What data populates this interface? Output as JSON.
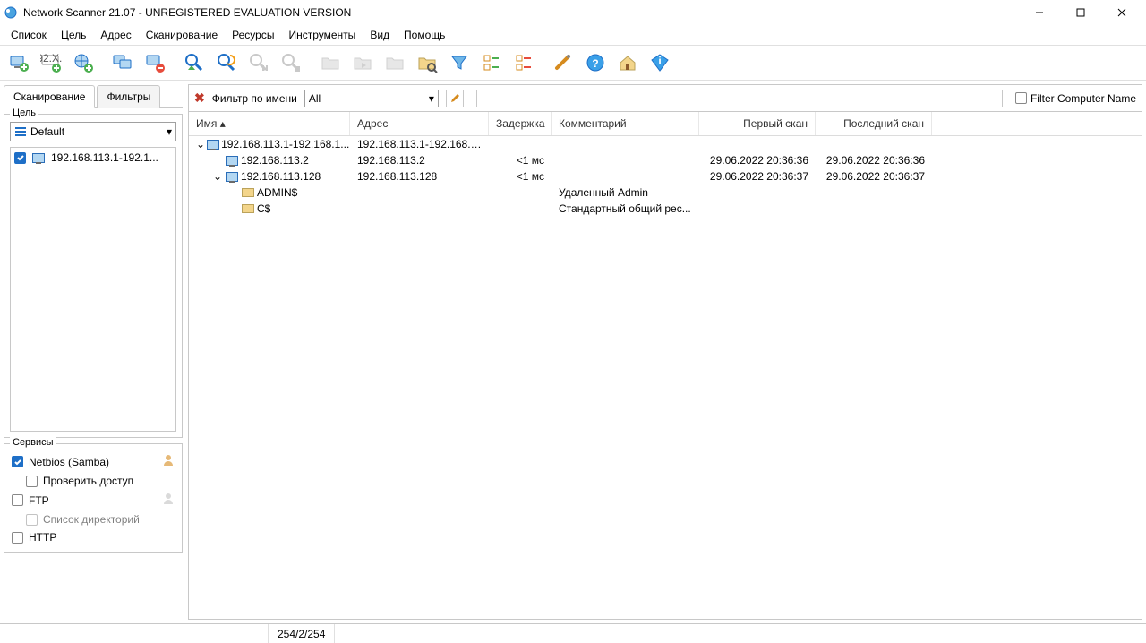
{
  "window": {
    "title": "Network Scanner 21.07 - UNREGISTERED EVALUATION VERSION"
  },
  "menubar": [
    "Список",
    "Цель",
    "Адрес",
    "Сканирование",
    "Ресурсы",
    "Инструменты",
    "Вид",
    "Помощь"
  ],
  "sidebar": {
    "tabs": {
      "scan": "Сканирование",
      "filters": "Фильтры"
    },
    "target_group": "Цель",
    "target_combo": "Default",
    "target_list_item": "192.168.113.1-192.1...",
    "services_group": "Сервисы",
    "svc_netbios": "Netbios (Samba)",
    "svc_netbios_check": "Проверить доступ",
    "svc_ftp": "FTP",
    "svc_ftp_dirlist": "Список директорий",
    "svc_http": "HTTP"
  },
  "filterbar": {
    "label": "Фильтр по имени",
    "combo": "All",
    "checkbox_label": "Filter Computer Name"
  },
  "columns": {
    "name": "Имя",
    "address": "Адрес",
    "delay": "Задержка",
    "comment": "Комментарий",
    "first_scan": "Первый скан",
    "last_scan": "Последний скан"
  },
  "rows": [
    {
      "level": 0,
      "expand": "open",
      "icon": "monitor",
      "name": "192.168.113.1-192.168.1...",
      "address": "192.168.113.1-192.168.11...",
      "delay": "",
      "comment": "",
      "first": "",
      "last": ""
    },
    {
      "level": 1,
      "expand": "none",
      "icon": "monitor",
      "name": "192.168.113.2",
      "address": "192.168.113.2",
      "delay": "<1 мс",
      "comment": "",
      "first": "29.06.2022 20:36:36",
      "last": "29.06.2022 20:36:36"
    },
    {
      "level": 1,
      "expand": "open",
      "icon": "monitor",
      "name": "192.168.113.128",
      "address": "192.168.113.128",
      "delay": "<1 мс",
      "comment": "",
      "first": "29.06.2022 20:36:37",
      "last": "29.06.2022 20:36:37"
    },
    {
      "level": 2,
      "expand": "none",
      "icon": "folder",
      "name": "ADMIN$",
      "address": "",
      "delay": "",
      "comment": "Удаленный Admin",
      "first": "",
      "last": ""
    },
    {
      "level": 2,
      "expand": "none",
      "icon": "folder",
      "name": "C$",
      "address": "",
      "delay": "",
      "comment": "Стандартный общий рес...",
      "first": "",
      "last": ""
    }
  ],
  "statusbar": {
    "count": "254/2/254"
  }
}
